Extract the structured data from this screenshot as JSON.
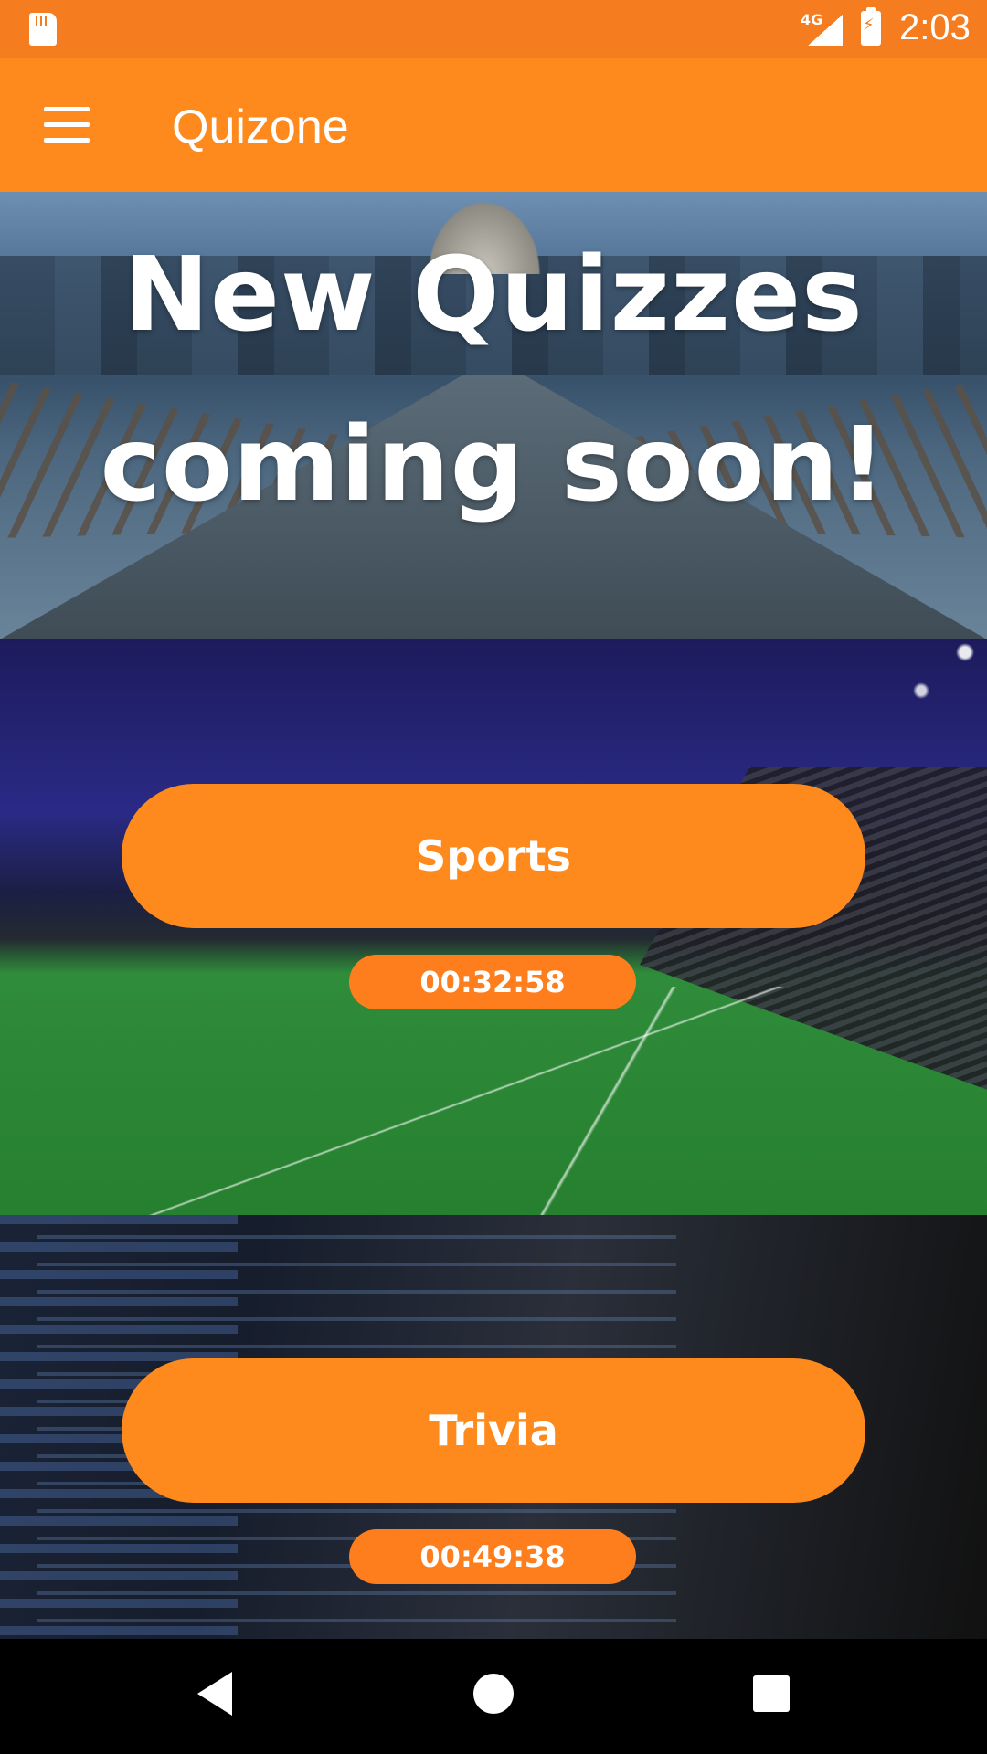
{
  "status_bar": {
    "network": "4G",
    "time": "2:03",
    "icons": [
      "sd-card-icon",
      "signal-icon",
      "battery-charging-icon"
    ]
  },
  "app_bar": {
    "title": "Quizone",
    "menu_icon": "menu-icon"
  },
  "hero": {
    "headline": "New Quizzes\ncoming soon!"
  },
  "quizzes": [
    {
      "label": "Sports",
      "timer": "00:32:58"
    },
    {
      "label": "Trivia",
      "timer": "00:49:38"
    }
  ],
  "nav_bar": {
    "icons": [
      "back-icon",
      "home-icon",
      "recents-icon"
    ]
  },
  "colors": {
    "status_bar": "#f57c1f",
    "accent": "#fe8a1d"
  }
}
